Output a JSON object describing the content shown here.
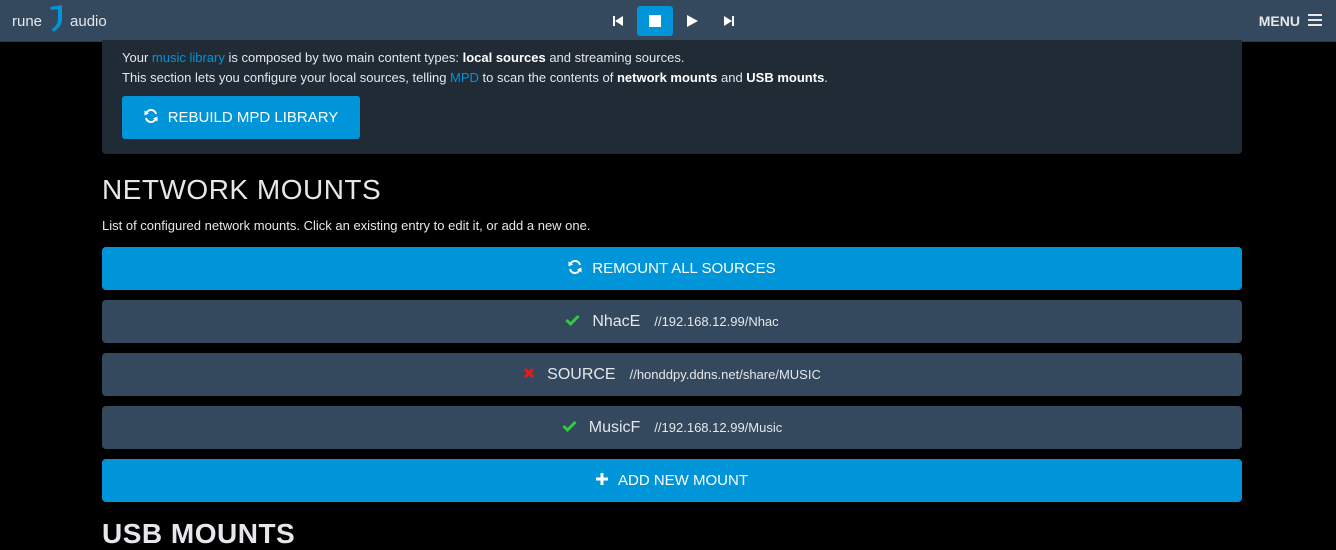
{
  "header": {
    "logo_left": "rune",
    "logo_right": "audio",
    "menu_label": "MENU",
    "transport": [
      {
        "name": "previous",
        "icon": "skip-previous-icon"
      },
      {
        "name": "stop",
        "icon": "stop-icon",
        "active": true
      },
      {
        "name": "play",
        "icon": "play-icon"
      },
      {
        "name": "next",
        "icon": "skip-next-icon"
      }
    ]
  },
  "info": {
    "line1": {
      "t1": "Your ",
      "link1": "music library",
      "t2": " is composed by two main content types: ",
      "b1": "local sources",
      "t3": " and streaming sources."
    },
    "line2": {
      "t1": "This section lets you configure your local sources, telling ",
      "link1": "MPD",
      "t2": " to scan the contents of ",
      "b1": "network mounts",
      "t3": " and ",
      "b2": "USB mounts",
      "t4": "."
    },
    "rebuild_label": "REBUILD MPD LIBRARY"
  },
  "network_mounts": {
    "title": "NETWORK MOUNTS",
    "description": "List of configured network mounts. Click an existing entry to edit it, or add a new one.",
    "remount_label": "REMOUNT ALL SOURCES",
    "mounts": [
      {
        "name": "NhacE",
        "path": "//192.168.12.99/Nhac",
        "status": "ok"
      },
      {
        "name": "SOURCE",
        "path": "//honddpy.ddns.net/share/MUSIC",
        "status": "error"
      },
      {
        "name": "MusicF",
        "path": "//192.168.12.99/Music",
        "status": "ok"
      }
    ],
    "add_label": "ADD NEW MOUNT"
  },
  "usb_mounts": {
    "title": "USB MOUNTS"
  },
  "colors": {
    "accent": "#0095d8",
    "topbar": "#34495e",
    "ok": "#2ecc40",
    "error": "#e81a1a"
  }
}
